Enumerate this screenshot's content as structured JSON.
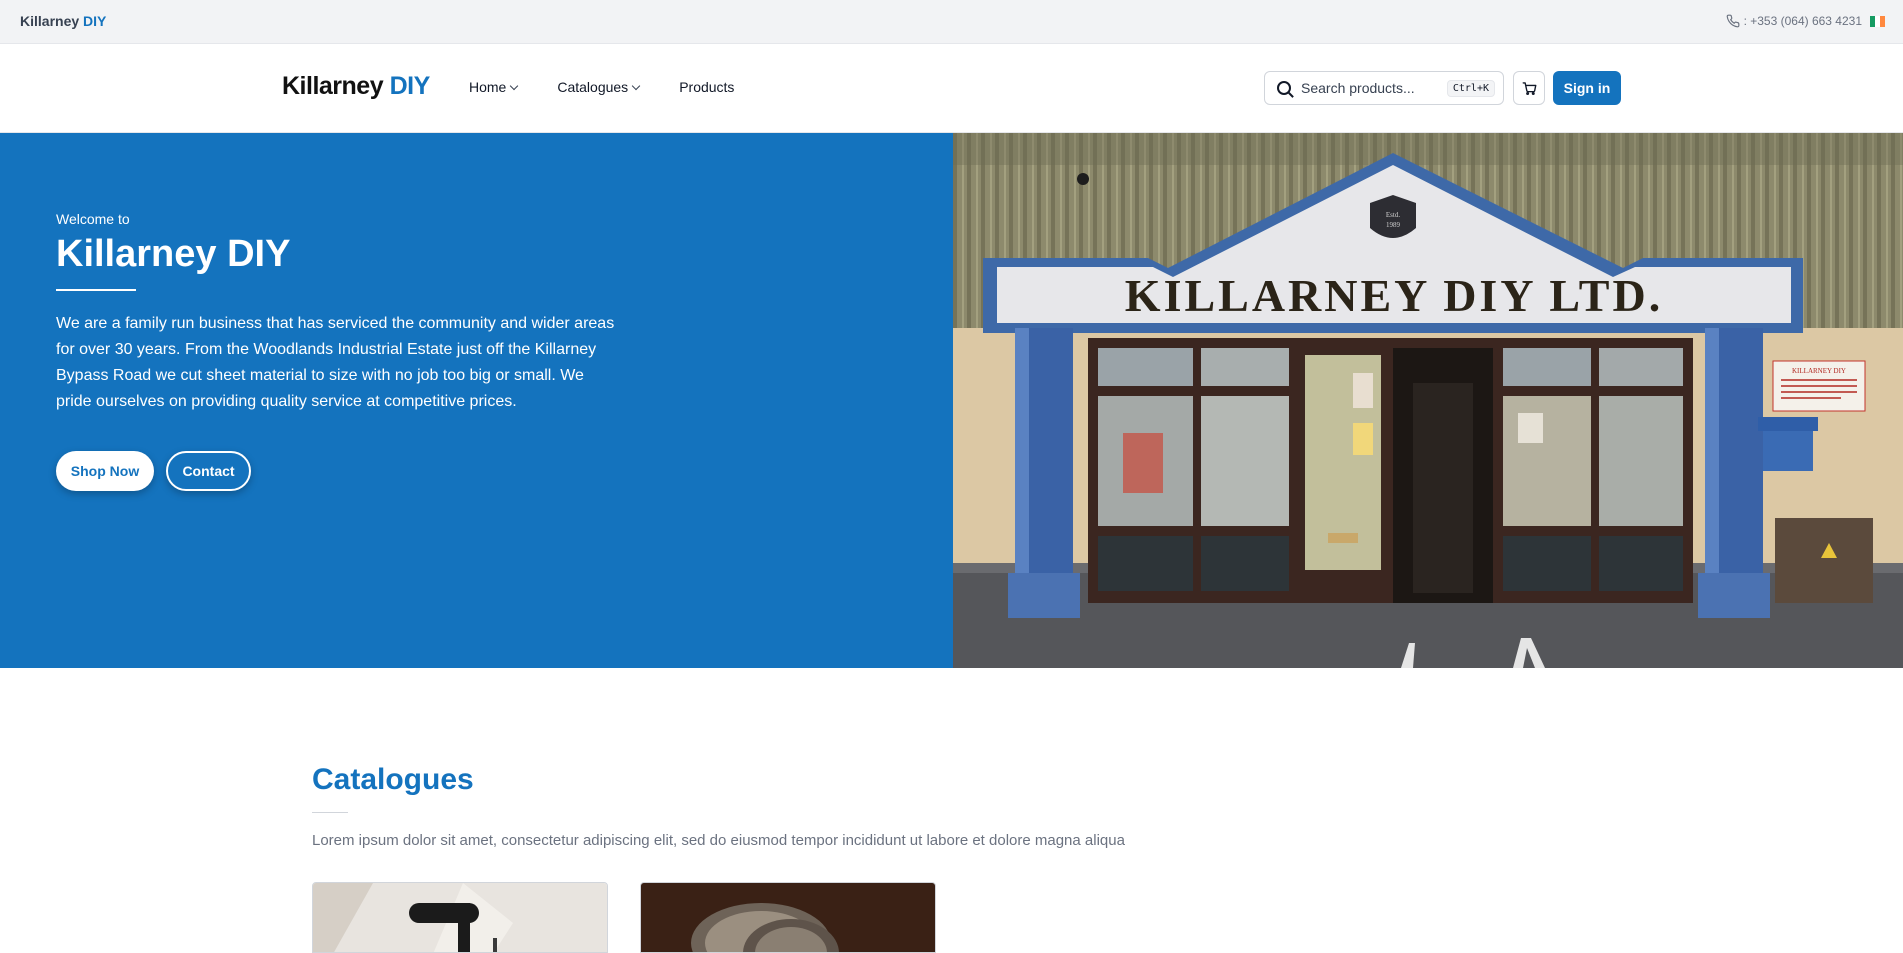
{
  "topbar": {
    "brand_main": "Killarney ",
    "brand_accent": "DIY",
    "phone": ": +353 (064) 663 4231",
    "flag_colors": [
      "#169b62",
      "#ffffff",
      "#ff883e"
    ]
  },
  "header": {
    "logo_main": "Killarney ",
    "logo_accent": "DIY",
    "nav": {
      "home": "Home",
      "catalogues": "Catalogues",
      "products": "Products"
    },
    "search": {
      "placeholder": "Search products...",
      "shortcut": "Ctrl+K"
    },
    "signin": "Sign in"
  },
  "hero": {
    "welcome": "Welcome to",
    "title": "Killarney DIY",
    "text": "We are a family run business that has serviced the community and wider areas for over 30 years. From the Woodlands Industrial Estate just off the Killarney Bypass Road we cut sheet material to size with no job too big or small. We pride ourselves on providing quality service at competitive prices.",
    "shop_now": "Shop Now",
    "contact": "Contact",
    "storefront": {
      "sign": "KILLARNEY DIY LTD.",
      "estd": "Estd.",
      "year": "1989",
      "notice": "KILLARNEY DIY"
    }
  },
  "catalogues": {
    "title": "Catalogues",
    "description": "Lorem ipsum dolor sit amet, consectetur adipiscing elit, sed do eiusmod tempor incididunt ut labore et dolore magna aliqua"
  },
  "colors": {
    "brand_blue": "#1473be"
  }
}
